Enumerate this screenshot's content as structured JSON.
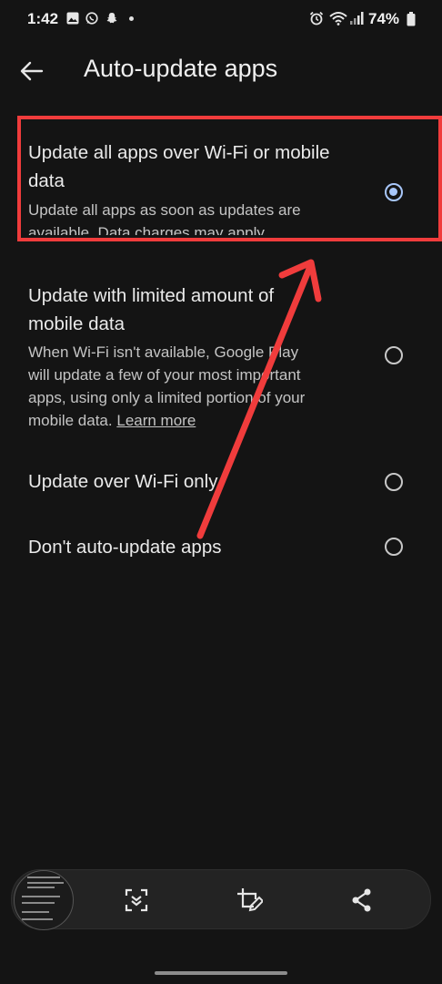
{
  "status_bar": {
    "time": "1:42",
    "battery": "74%",
    "notification_icons": [
      "gallery-icon",
      "whatsapp-icon",
      "snapchat-icon"
    ],
    "system_icons": [
      "alarm-icon",
      "wifi-icon",
      "signal-icon",
      "battery-icon"
    ]
  },
  "header": {
    "title": "Auto-update apps"
  },
  "options": [
    {
      "title_line1": "Update all apps over Wi-Fi or mobile",
      "title_line2": "data",
      "description_line1": "Update all apps as soon as updates are",
      "description_line2": "available. Data charges may apply.",
      "selected": true
    },
    {
      "title_line1": "Update with limited amount of",
      "title_line2": "mobile data",
      "description_line1": "When Wi-Fi isn't available, Google Play",
      "description_line2": "will update a few of your most important",
      "description_line3": "apps, using only a limited portion of your",
      "description_line4_prefix": "mobile data.",
      "learn_more": "Learn more",
      "selected": false
    },
    {
      "title": "Update over Wi-Fi only",
      "selected": false
    },
    {
      "title": "Don't auto-update apps",
      "selected": false
    }
  ],
  "annotation": {
    "color": "#f03c3c"
  },
  "screenshot_toolbar": {
    "tools": [
      "scan-icon",
      "crop-edit-icon",
      "share-icon"
    ]
  },
  "colors": {
    "background": "#141414",
    "accent": "#a8c7fa"
  }
}
